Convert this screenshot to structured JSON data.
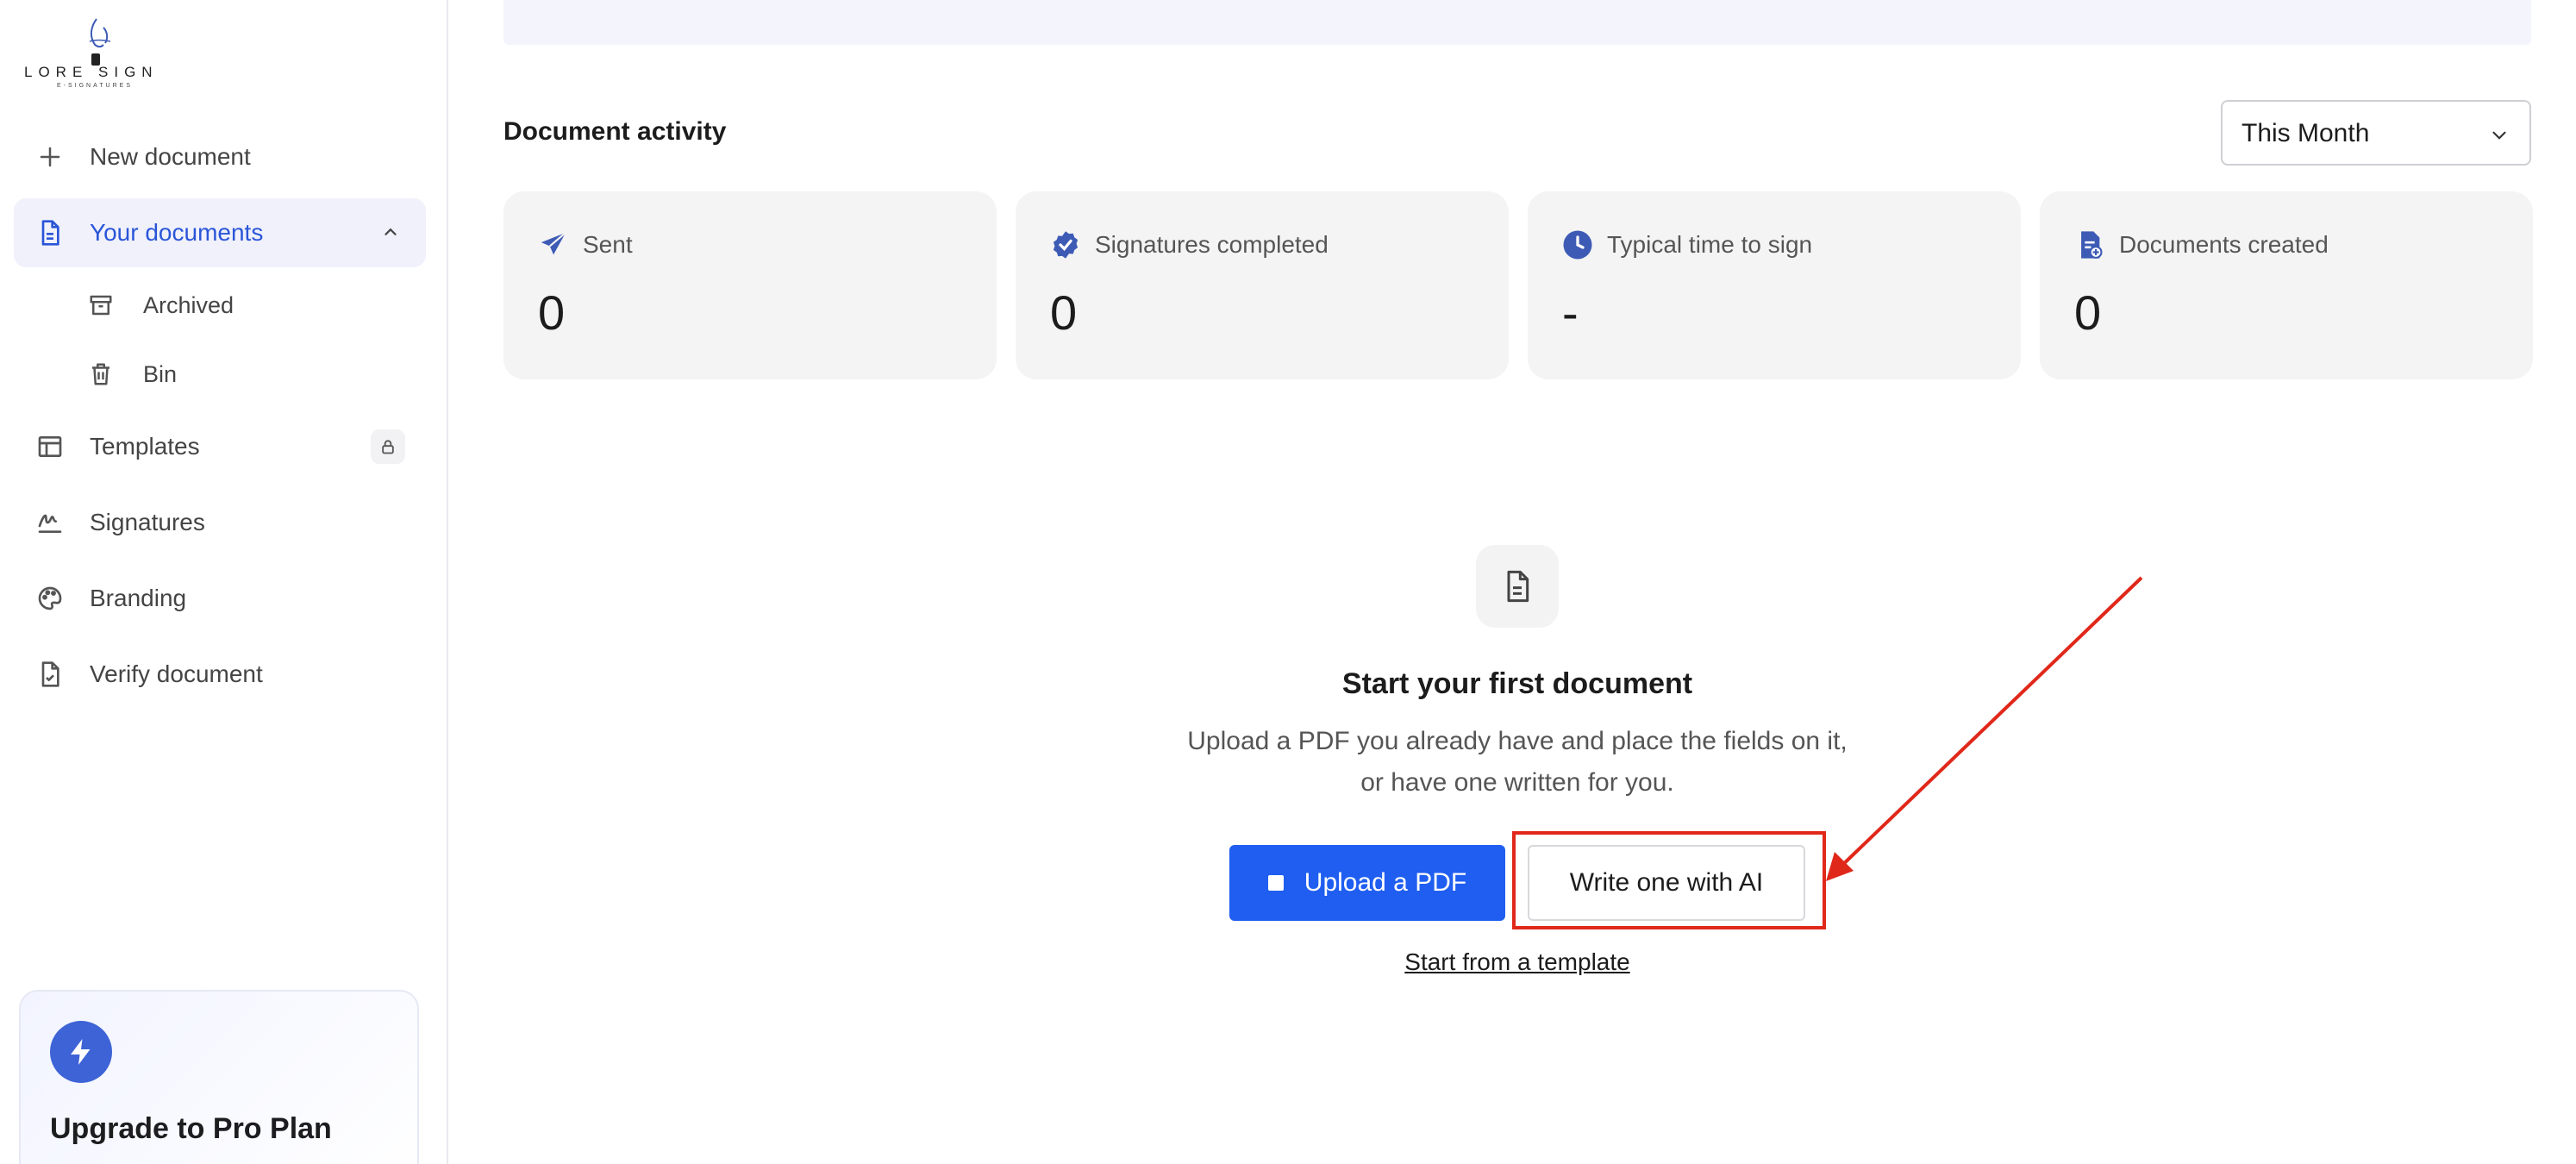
{
  "sidebar": {
    "logo": {
      "word": "LORE SIGN",
      "sub": "E-SIGNATURES"
    },
    "items": [
      {
        "label": "New document",
        "icon": "plus-icon"
      },
      {
        "label": "Your documents",
        "icon": "file-icon",
        "active": true,
        "expanded": true
      },
      {
        "label": "Archived",
        "icon": "archive-icon",
        "sub": true
      },
      {
        "label": "Bin",
        "icon": "trash-icon",
        "sub": true
      },
      {
        "label": "Templates",
        "icon": "layout-icon",
        "locked": true
      },
      {
        "label": "Signatures",
        "icon": "signature-icon"
      },
      {
        "label": "Branding",
        "icon": "palette-icon"
      },
      {
        "label": "Verify document",
        "icon": "file-check-icon"
      }
    ],
    "upgrade": {
      "title": "Upgrade to Pro Plan",
      "icon": "bolt-icon"
    }
  },
  "activity": {
    "title": "Document activity",
    "period": "This Month",
    "stats": [
      {
        "label": "Sent",
        "value": "0",
        "icon": "send-icon"
      },
      {
        "label": "Signatures completed",
        "value": "0",
        "icon": "badge-check-icon"
      },
      {
        "label": "Typical time to sign",
        "value": "-",
        "icon": "clock-icon"
      },
      {
        "label": "Documents created",
        "value": "0",
        "icon": "file-plus-icon"
      }
    ]
  },
  "empty_state": {
    "title": "Start your first document",
    "desc_line1": "Upload a PDF you already have and place the fields on it,",
    "desc_line2": "or have one written for you.",
    "upload_label": "Upload a PDF",
    "ai_label": "Write one with AI",
    "template_link": "Start from a template"
  },
  "colors": {
    "accent": "#2a55d8",
    "primary_button": "#1f5ef0",
    "annotation": "#e0281a",
    "card_bg": "#f4f4f5"
  }
}
